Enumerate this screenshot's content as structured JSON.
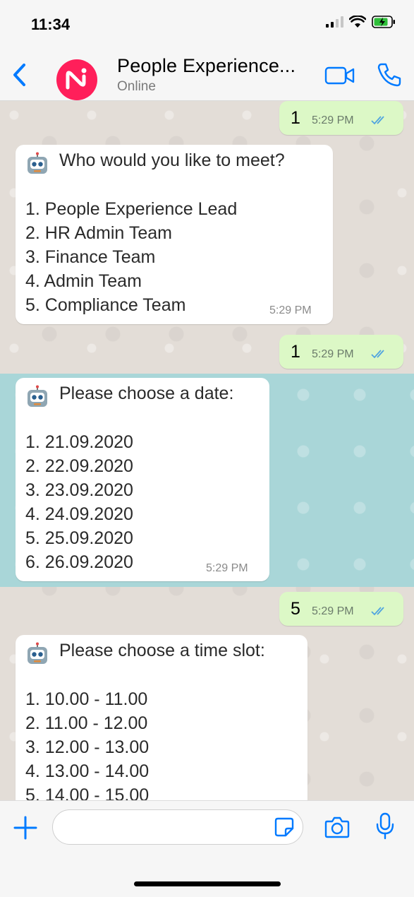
{
  "status_bar": {
    "time": "11:34"
  },
  "header": {
    "title": "People Experience...",
    "status": "Online",
    "avatar_color": "#ff1f5a"
  },
  "colors": {
    "accent": "#007aff",
    "outgoing_bubble": "#dcf8c6",
    "incoming_bubble": "#ffffff",
    "highlight_band": "#a9d6d8"
  },
  "messages": [
    {
      "direction": "out",
      "text": "1",
      "time": "5:29 PM"
    },
    {
      "direction": "in",
      "heading": "Who would you like to meet?",
      "lines": [
        "1. People Experience Lead",
        "2. HR Admin Team",
        "3. Finance Team",
        "4. Admin Team",
        "5. Compliance Team"
      ],
      "time": "5:29 PM"
    },
    {
      "direction": "out",
      "text": "1",
      "time": "5:29 PM"
    },
    {
      "direction": "in",
      "heading": "Please choose a date:",
      "lines": [
        "1. 21.09.2020",
        "2. 22.09.2020",
        "3. 23.09.2020",
        "4. 24.09.2020",
        "5. 25.09.2020",
        "6. 26.09.2020"
      ],
      "time": "5:29 PM",
      "highlighted": true
    },
    {
      "direction": "out",
      "text": "5",
      "time": "5:29 PM"
    },
    {
      "direction": "in",
      "heading": "Please choose a time slot:",
      "lines": [
        "1. 10.00 - 11.00",
        "2. 11.00 - 12.00",
        "3. 12.00 - 13.00",
        "4. 13.00 - 14.00",
        "5. 14.00 - 15.00"
      ]
    }
  ],
  "composer": {
    "placeholder": ""
  }
}
